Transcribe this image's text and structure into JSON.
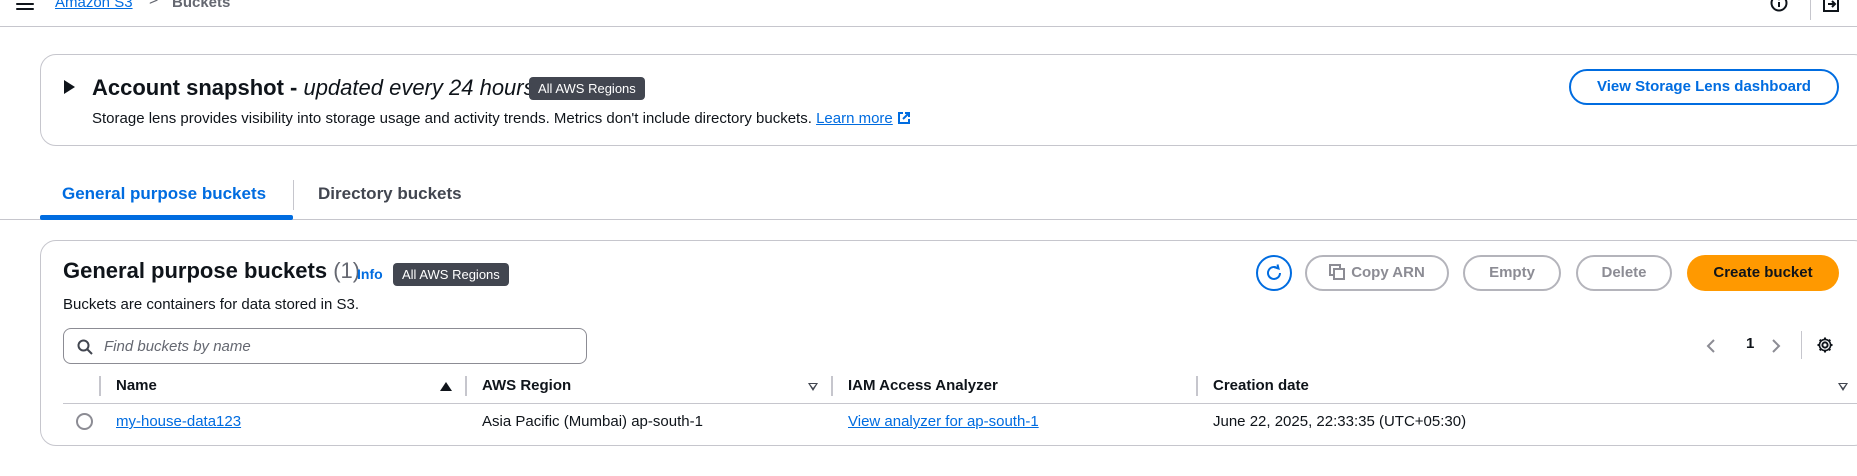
{
  "breadcrumb": {
    "root": "Amazon S3",
    "separator": ">",
    "current": "Buckets"
  },
  "snapshot": {
    "title": "Account snapshot - ",
    "subtitle": "updated every 24 hours",
    "badge": "All AWS Regions",
    "description": "Storage lens provides visibility into storage usage and activity trends. Metrics don't include directory buckets. ",
    "learn_more": "Learn more",
    "lens_button": "View Storage Lens dashboard"
  },
  "tabs": [
    {
      "label": "General purpose buckets",
      "active": true
    },
    {
      "label": "Directory buckets",
      "active": false
    }
  ],
  "panel": {
    "title": "General purpose buckets",
    "count": "(1)",
    "info": "Info",
    "badge": "All AWS Regions",
    "description": "Buckets are containers for data stored in S3.",
    "buttons": {
      "copy_arn": "Copy ARN",
      "empty": "Empty",
      "delete": "Delete",
      "create": "Create bucket"
    },
    "search_placeholder": "Find buckets by name",
    "page": "1"
  },
  "table": {
    "columns": [
      "Name",
      "AWS Region",
      "IAM Access Analyzer",
      "Creation date"
    ],
    "rows": [
      {
        "name": "my-house-data123",
        "region": "Asia Pacific (Mumbai) ap-south-1",
        "analyzer": "View analyzer for ap-south-1",
        "created": "June 22, 2025, 22:33:35 (UTC+05:30)"
      }
    ]
  },
  "colors": {
    "link": "#006ce0",
    "primary": "#ff9900",
    "badge": "#424650",
    "border": "#c6c6cd"
  }
}
